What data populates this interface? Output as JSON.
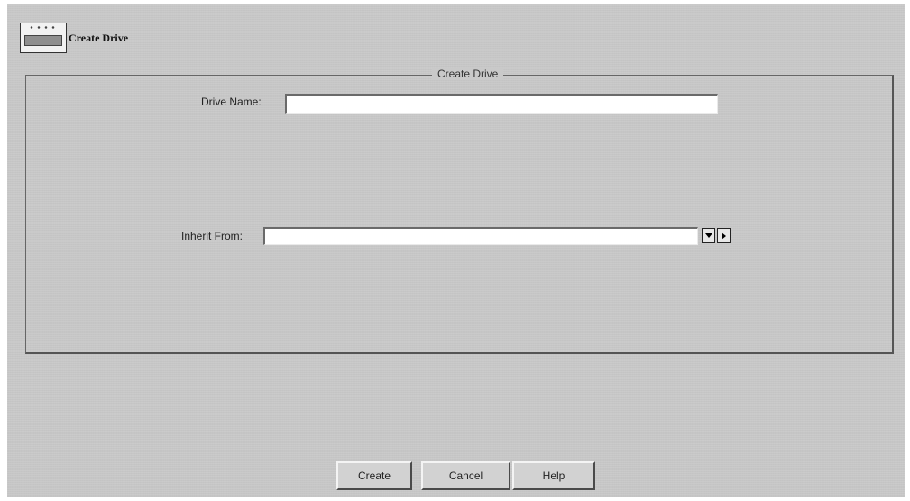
{
  "header": {
    "icon": "drive-icon",
    "title": "Create Drive"
  },
  "group": {
    "legend": "Create Drive"
  },
  "fields": {
    "drive_name": {
      "label": "Drive Name:",
      "value": ""
    },
    "inherit_from": {
      "label": "Inherit From:",
      "value": ""
    }
  },
  "buttons": {
    "create": "Create",
    "cancel": "Cancel",
    "help": "Help"
  }
}
